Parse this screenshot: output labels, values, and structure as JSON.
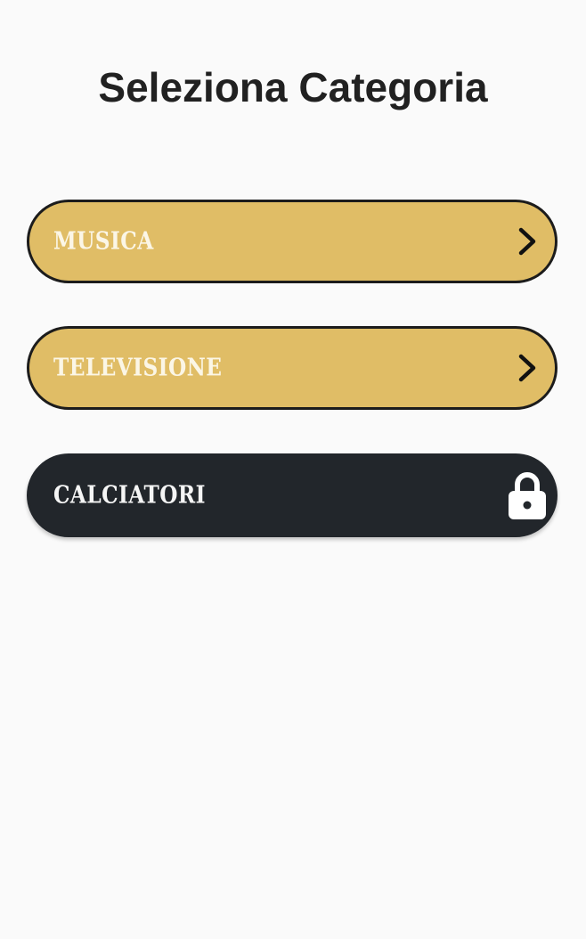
{
  "header": {
    "title": "Seleziona Categoria"
  },
  "categories": [
    {
      "label": "MUSICA",
      "locked": false,
      "icon": "chevron-right-icon"
    },
    {
      "label": "TELEVISIONE",
      "locked": false,
      "icon": "chevron-right-icon"
    },
    {
      "label": "CALCIATORI",
      "locked": true,
      "icon": "lock-icon"
    }
  ],
  "colors": {
    "background": "#fafafa",
    "unlocked_fill": "#e0bd66",
    "locked_fill": "#22262b",
    "title_text": "#212121"
  }
}
